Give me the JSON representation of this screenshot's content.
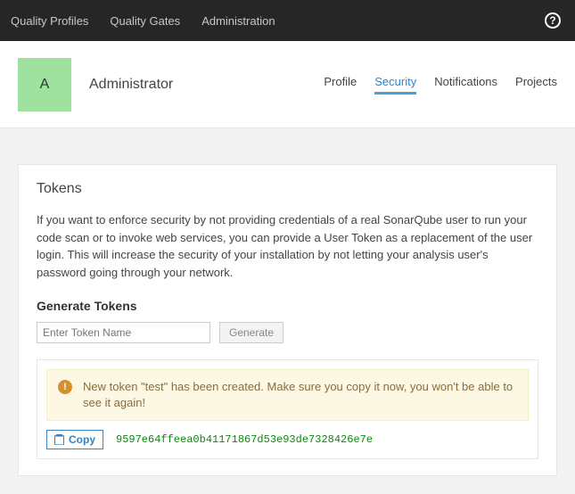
{
  "topnav": {
    "items": [
      "Quality Profiles",
      "Quality Gates",
      "Administration"
    ]
  },
  "header": {
    "avatar_letter": "A",
    "username": "Administrator",
    "tabs": [
      {
        "label": "Profile",
        "active": false
      },
      {
        "label": "Security",
        "active": true
      },
      {
        "label": "Notifications",
        "active": false
      },
      {
        "label": "Projects",
        "active": false
      }
    ]
  },
  "card": {
    "title": "Tokens",
    "description": "If you want to enforce security by not providing credentials of a real SonarQube user to run your code scan or to invoke web services, you can provide a User Token as a replacement of the user login. This will increase the security of your installation by not letting your analysis user's password going through your network.",
    "generate_heading": "Generate Tokens",
    "token_name_placeholder": "Enter Token Name",
    "token_name_value": "",
    "generate_button": "Generate",
    "alert_text": "New token \"test\" has been created. Make sure you copy it now, you won't be able to see it again!",
    "copy_button": "Copy",
    "token_value": "9597e64ffeea0b41171867d53e93de7328426e7e"
  }
}
